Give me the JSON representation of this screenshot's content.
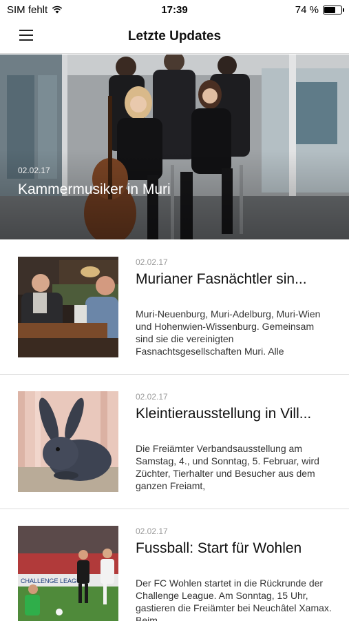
{
  "status_bar": {
    "carrier": "SIM fehlt",
    "time": "17:39",
    "battery_percent": "74 %",
    "battery_level": 0.74
  },
  "nav": {
    "title": "Letzte Updates",
    "menu_icon": "hamburger-menu-icon"
  },
  "hero": {
    "date": "02.02.17",
    "title": "Kammermusiker in Muri"
  },
  "articles": [
    {
      "date": "02.02.17",
      "title": "Murianer Fasnächtler sin...",
      "teaser": "Muri-Neuenburg, Muri-Adelburg, Muri-Wien und Hohenwien-Wissenburg. Gemeinsam sind sie die vereinigten Fasnachtsgesellschaften Muri. Alle"
    },
    {
      "date": "02.02.17",
      "title": "Kleintierausstellung in Vill...",
      "teaser": "Die Freiämter Verbandsausstellung am Samstag, 4., und Sonntag, 5. Februar, wird Züchter, Tierhalter und Besucher aus dem ganzen Freiamt,"
    },
    {
      "date": "02.02.17",
      "title": "Fussball: Start für Wohlen",
      "teaser": "Der FC Wohlen startet in die Rückrunde der Challenge League. Am Sonntag, 15 Uhr, gastieren die Freiämter bei Neuchâtel Xamax. Beim"
    }
  ],
  "photo_text": {
    "ad_board": "CHALLENGE LEAGUE"
  }
}
